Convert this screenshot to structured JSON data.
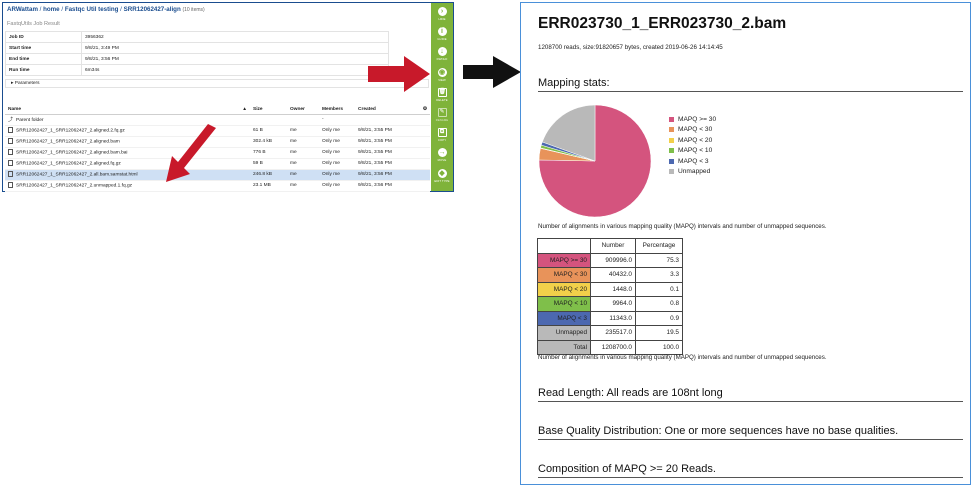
{
  "file_manager": {
    "breadcrumb": {
      "home_root": "ARWattam",
      "sep1": " / ",
      "home": "home",
      "sep2": " / ",
      "folder": "Fastqc Util testing",
      "sep3": " / ",
      "current": "SRR12062427-align",
      "count": "(10 items)"
    },
    "subtitle": "FastqUtils Job Result",
    "meta": [
      {
        "key": "Job ID",
        "value": "3956362"
      },
      {
        "key": "Start time",
        "value": "9/8/21, 3:49 PM"
      },
      {
        "key": "End time",
        "value": "9/8/21, 3:56 PM"
      },
      {
        "key": "Run time",
        "value": "6m34s"
      }
    ],
    "parameters_label": "Parameters",
    "columns": {
      "name": "Name",
      "size": "Size",
      "owner": "Owner",
      "members": "Members",
      "created": "Created",
      "sort_glyph": "▲",
      "settings_glyph": "⚙"
    },
    "parent_folder": {
      "name": "Parent folder",
      "size": "",
      "owner": "",
      "members": "-",
      "created": ""
    },
    "files": [
      {
        "name": "SRR12062427_1_SRR12062427_2.aligned.2.fq.gz",
        "size": "61 B",
        "owner": "me",
        "members": "Only me",
        "created": "9/8/21, 3:55 PM",
        "selected": false
      },
      {
        "name": "SRR12062427_1_SRR12062427_2.aligned.bam",
        "size": "302.4 kB",
        "owner": "me",
        "members": "Only me",
        "created": "9/8/21, 3:55 PM",
        "selected": false
      },
      {
        "name": "SRR12062427_1_SRR12062427_2.aligned.bam.bai",
        "size": "776 B",
        "owner": "me",
        "members": "Only me",
        "created": "9/8/21, 3:55 PM",
        "selected": false
      },
      {
        "name": "SRR12062427_1_SRR12062427_2.aligned.fq.gz",
        "size": "59 B",
        "owner": "me",
        "members": "Only me",
        "created": "9/8/21, 3:55 PM",
        "selected": false
      },
      {
        "name": "SRR12062427_1_SRR12062427_2.all.bam.samstat.html",
        "size": "246.8 kB",
        "owner": "me",
        "members": "Only me",
        "created": "9/8/21, 3:56 PM",
        "selected": true
      },
      {
        "name": "SRR12062427_1_SRR12062427_2.unmapped.1.fq.gz",
        "size": "23.1 MB",
        "owner": "me",
        "members": "Only me",
        "created": "9/8/21, 3:56 PM",
        "selected": false
      }
    ],
    "toolbar": [
      {
        "name": "hide-button",
        "icon": "chevron-right-icon",
        "glyph": "›",
        "label": "HIDE",
        "dim": false
      },
      {
        "name": "guide-button",
        "icon": "info-icon",
        "glyph": "i",
        "label": "GUIDE",
        "dim": false
      },
      {
        "name": "download-button",
        "icon": "download-icon",
        "glyph": "↓",
        "label": "DWNLD",
        "dim": false
      },
      {
        "name": "view-button",
        "icon": "eye-icon",
        "glyph": "◉",
        "label": "VIEW",
        "dim": false
      },
      {
        "name": "delete-button",
        "icon": "trash-icon",
        "glyph": "🗑",
        "label": "DELETE",
        "dim": false
      },
      {
        "name": "rename-button",
        "icon": "pencil-icon",
        "glyph": "✎",
        "label": "RENAME",
        "dim": true
      },
      {
        "name": "copy-button",
        "icon": "copy-icon",
        "glyph": "⧉",
        "label": "COPY",
        "dim": false
      },
      {
        "name": "move-button",
        "icon": "arrow-right-icon",
        "glyph": "→",
        "label": "MOVE",
        "dim": false
      },
      {
        "name": "edit-type-button",
        "icon": "tag-icon",
        "glyph": "◆",
        "label": "EDIT TYPE",
        "dim": false
      }
    ]
  },
  "report": {
    "title": "ERR023730_1_ERR023730_2.bam",
    "info": "1208700 reads, size:91820657 bytes, created 2019-06-26 14:14:45",
    "mapping_stats_heading": "Mapping stats:",
    "caption1": "Number of alignments in various mapping quality (MAPQ) intervals and number of unmapped sequences.",
    "caption2": "Number of alignments in various mapping quality (MAPQ) intervals and number of unmapped sequences.",
    "table_headers": {
      "number": "Number",
      "percentage": "Percentage"
    },
    "rows": [
      {
        "label": "MAPQ >= 30",
        "number": "909996.0",
        "percentage": "75.3",
        "color": "#d4547e"
      },
      {
        "label": "MAPQ < 30",
        "number": "40432.0",
        "percentage": "3.3",
        "color": "#e8935a"
      },
      {
        "label": "MAPQ < 20",
        "number": "1448.0",
        "percentage": "0.1",
        "color": "#f2d04a"
      },
      {
        "label": "MAPQ < 10",
        "number": "9964.0",
        "percentage": "0.8",
        "color": "#7fbf4a"
      },
      {
        "label": "MAPQ < 3",
        "number": "11343.0",
        "percentage": "0.9",
        "color": "#4c68b0"
      },
      {
        "label": "Unmapped",
        "number": "235517.0",
        "percentage": "19.5",
        "color": "#b9b9b9"
      },
      {
        "label": "Total",
        "number": "1208700.0",
        "percentage": "100.0",
        "color": "#b9b9b9"
      }
    ],
    "sections": [
      "Read Length: All reads are 108nt long",
      "Base Quality Distribution: One or more sequences have no base qualities.",
      "Composition of MAPQ >= 20 Reads."
    ]
  },
  "chart_data": {
    "type": "pie",
    "categories": [
      "MAPQ >= 30",
      "MAPQ < 30",
      "MAPQ < 20",
      "MAPQ < 10",
      "MAPQ < 3",
      "Unmapped"
    ],
    "values": [
      909996,
      40432,
      1448,
      9964,
      11343,
      235517
    ],
    "colors": [
      "#d4547e",
      "#e8935a",
      "#f2d04a",
      "#7fbf4a",
      "#4c68b0",
      "#b9b9b9"
    ],
    "legend": "right"
  },
  "colors": {
    "arrow_red": "#c8192a",
    "arrow_black": "#111111",
    "toolbar_green": "#7fb33a",
    "link_blue": "#1a4d8f"
  }
}
